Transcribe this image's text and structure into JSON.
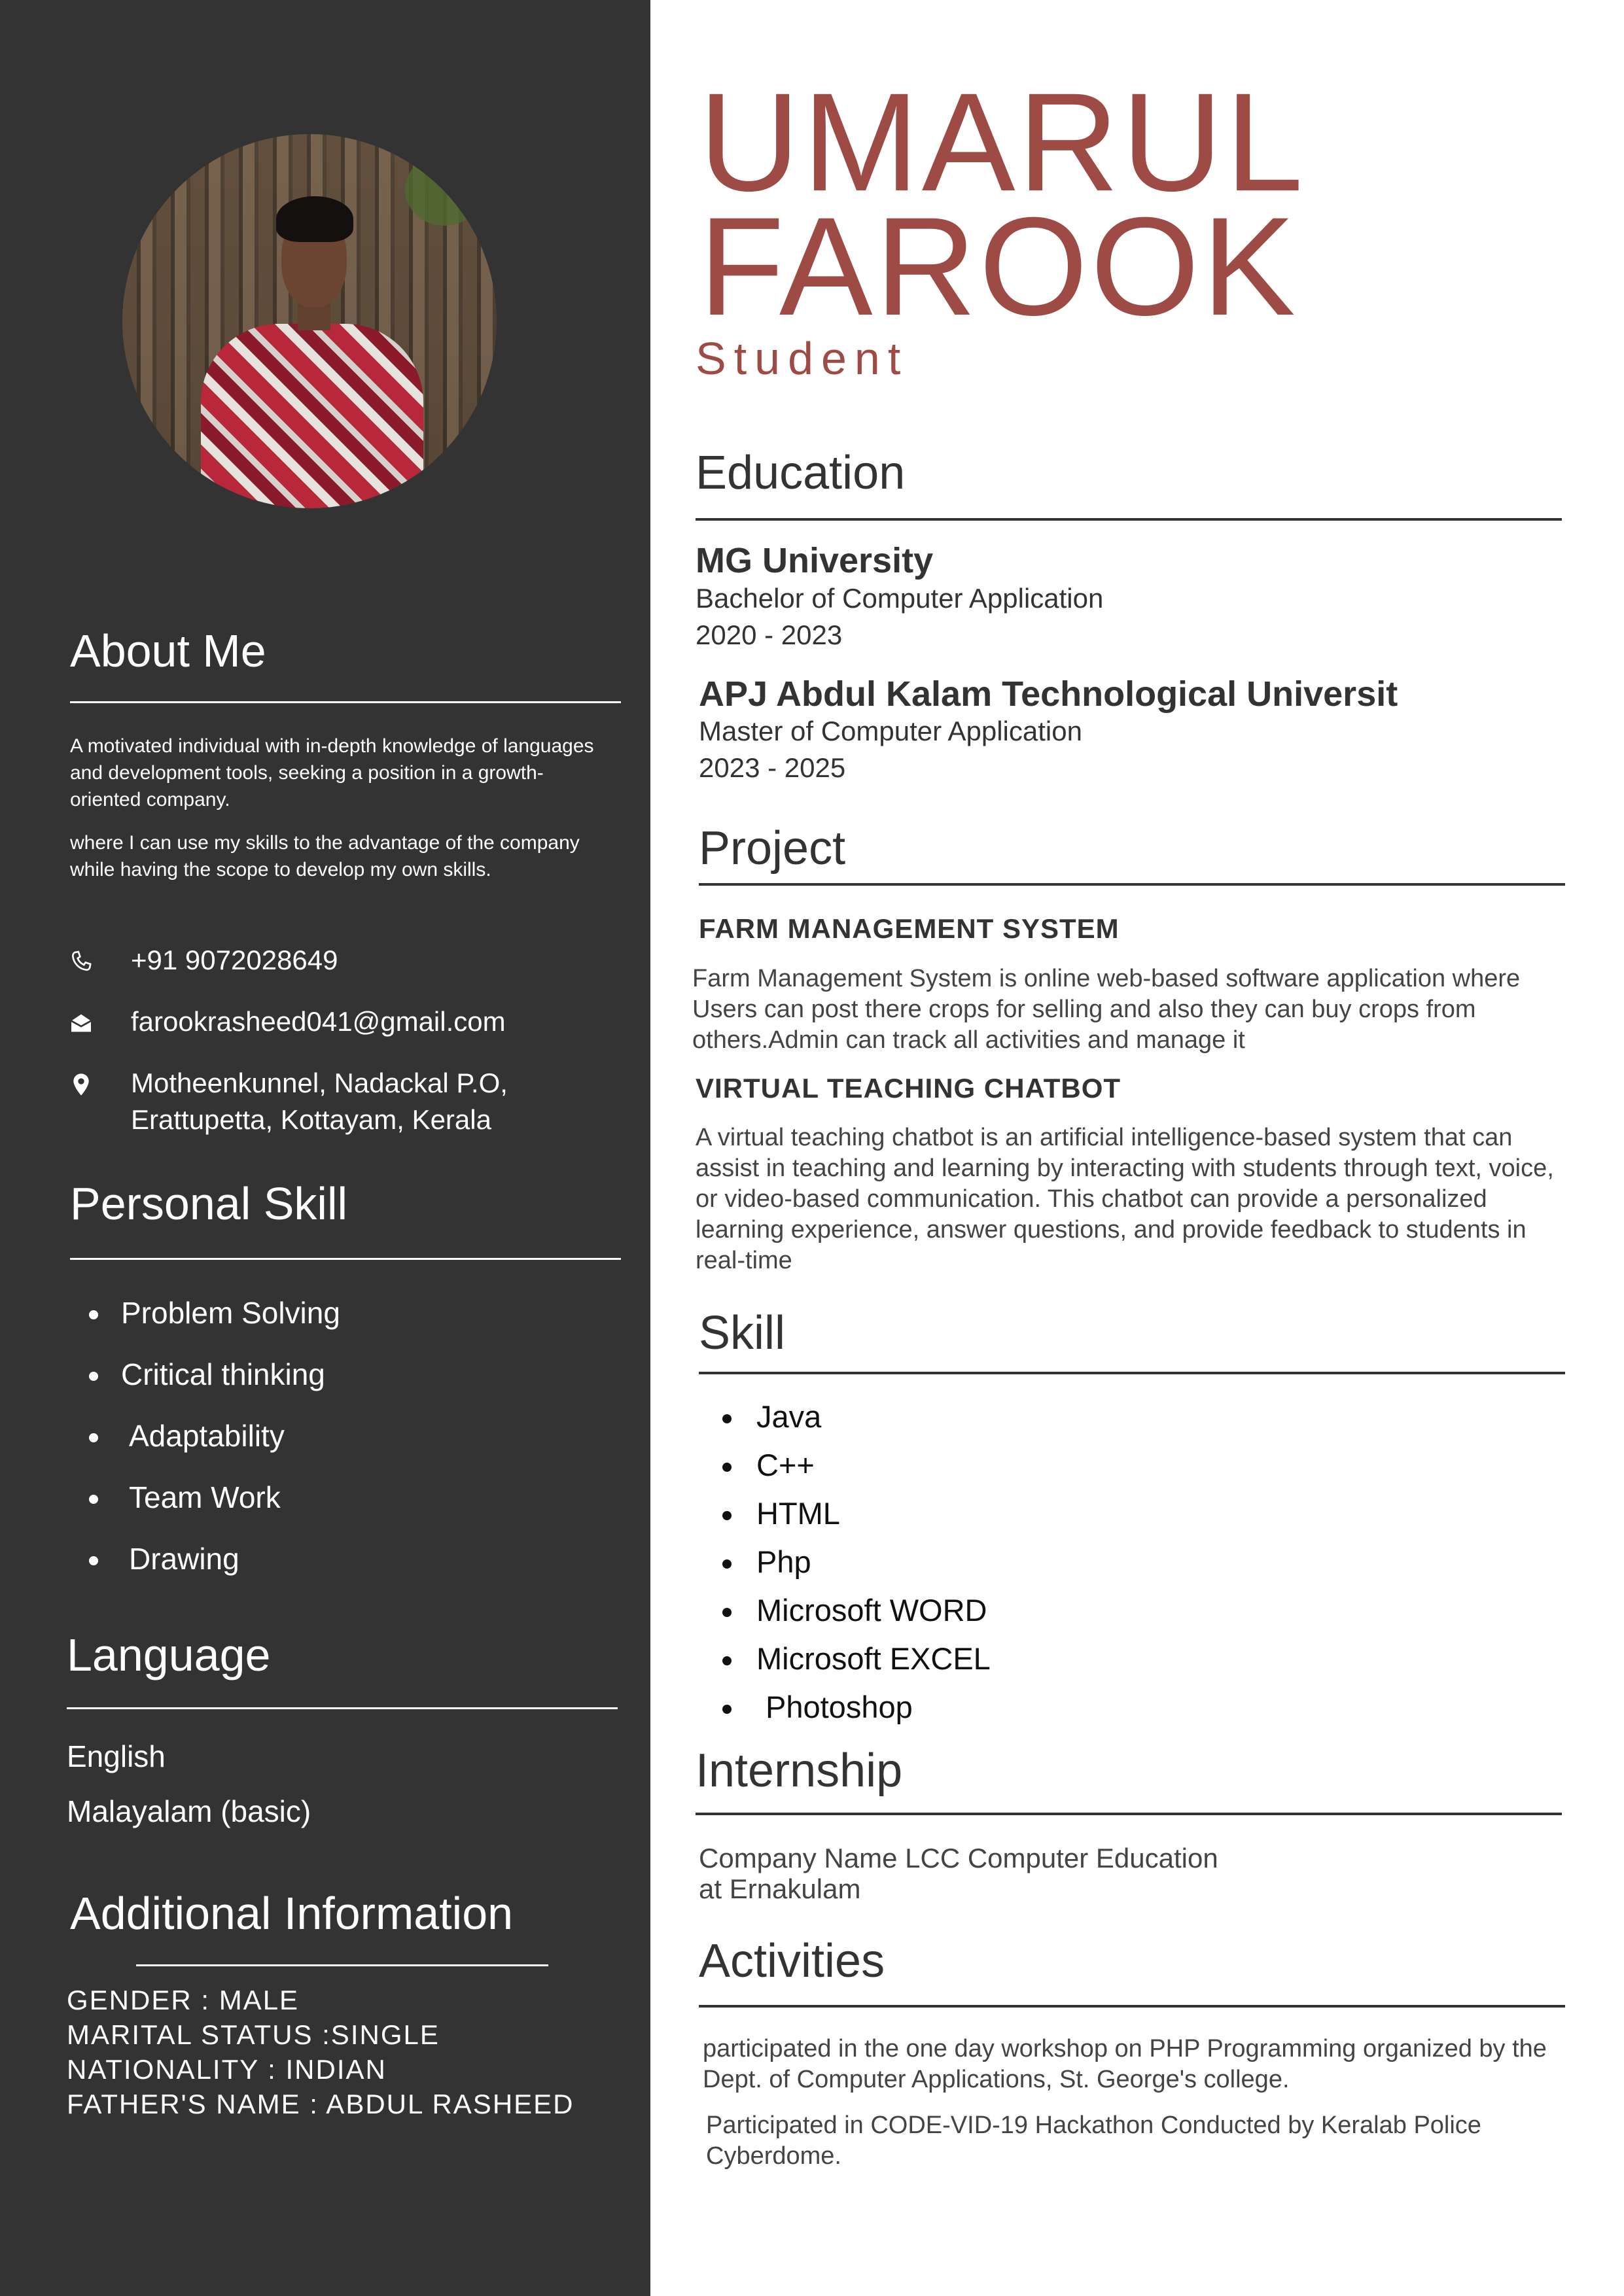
{
  "sidebar": {
    "about": {
      "title": "About Me",
      "p1": "A motivated individual with in-depth knowledge of languages and development tools, seeking a position in a growth-oriented company.",
      "p2": "where I can use my skills to the advantage of the company while having the scope to develop my own skills."
    },
    "contact": {
      "phone": "+91 9072028649",
      "email": "farookrasheed041@gmail.com",
      "address_line1": "Motheenkunnel, Nadackal P.O,",
      "address_line2": "Erattupetta, Kottayam, Kerala",
      "phone_icon": "phone-icon",
      "email_icon": "envelope-icon",
      "address_icon": "map-pin-icon"
    },
    "personal_skill": {
      "title": "Personal Skill",
      "items": [
        "Problem Solving",
        "Critical thinking",
        "Adaptability",
        "Team Work",
        "Drawing"
      ]
    },
    "language": {
      "title": "Language",
      "items": [
        "English",
        "Malayalam (basic)"
      ]
    },
    "additional": {
      "title": "Additional Information",
      "items": [
        "GENDER : MALE",
        "MARITAL STATUS :SINGLE",
        "NATIONALITY : INDIAN",
        "FATHER'S NAME : ABDUL RASHEED"
      ]
    }
  },
  "main": {
    "first_name": "UMARUL",
    "last_name": "FAROOK",
    "role": "Student",
    "education": {
      "title": "Education",
      "items": [
        {
          "school": "MG University",
          "degree": "Bachelor of Computer Application",
          "years": "2020 - 2023"
        },
        {
          "school": "APJ Abdul Kalam Technological Universit",
          "degree": "Master of Computer Application",
          "years": "2023 - 2025"
        }
      ]
    },
    "project": {
      "title": "Project",
      "items": [
        {
          "name": "FARM MANAGEMENT SYSTEM",
          "desc": "Farm Management System is online web-based software application where Users can post there crops for selling and also they can buy crops from others.Admin can track all activities and manage it"
        },
        {
          "name": "VIRTUAL TEACHING CHATBOT",
          "desc": "A virtual teaching chatbot is an artificial intelligence-based system that can assist in teaching and learning by interacting with students through text, voice, or video-based communication. This chatbot can provide a personalized learning experience, answer questions, and provide feedback to students in real-time"
        }
      ]
    },
    "skill": {
      "title": "Skill",
      "items": [
        "Java",
        "C++",
        "HTML",
        "Php",
        "Microsoft WORD",
        "Microsoft EXCEL",
        "Photoshop"
      ]
    },
    "internship": {
      "title": "Internship",
      "line1": "Company Name LCC Computer Education",
      "line2": "at Ernakulam"
    },
    "activities": {
      "title": "Activities",
      "p1": "participated in the one day workshop on PHP Programming organized by the Dept. of Computer Applications, St. George's college.",
      "p2": "Participated in CODE-VID-19 Hackathon Conducted by Keralab Police Cyberdome."
    }
  },
  "colors": {
    "sidebar_bg": "#333333",
    "accent": "#9e4a45",
    "main_text": "#333333"
  }
}
